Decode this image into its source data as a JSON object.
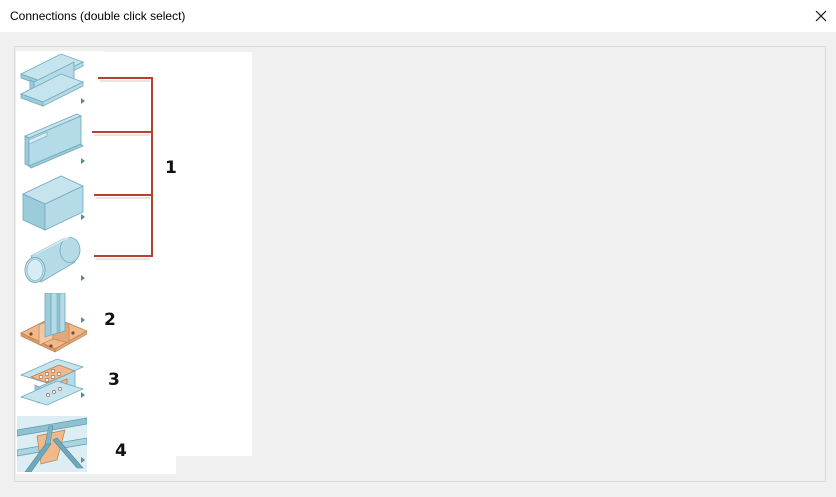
{
  "window": {
    "title": "Connections (double click select)"
  },
  "items": [
    {
      "icon": "i-beam-icon",
      "kind": "I-beam"
    },
    {
      "icon": "channel-beam-icon",
      "kind": "Channel"
    },
    {
      "icon": "box-section-icon",
      "kind": "Rectangular hollow section"
    },
    {
      "icon": "pipe-section-icon",
      "kind": "Circular hollow section"
    },
    {
      "icon": "base-plate-icon",
      "kind": "Base plate"
    },
    {
      "icon": "splice-plate-icon",
      "kind": "Splice"
    },
    {
      "icon": "bracing-gusset-icon",
      "kind": "Bracing gusset"
    }
  ],
  "callouts": {
    "c1": "1",
    "c2": "2",
    "c3": "3",
    "c4": "4"
  },
  "colors": {
    "steel": "#a9d4e0",
    "plate": "#efb98c",
    "bracket": "#b5412f",
    "background": "#f0f0f0"
  }
}
